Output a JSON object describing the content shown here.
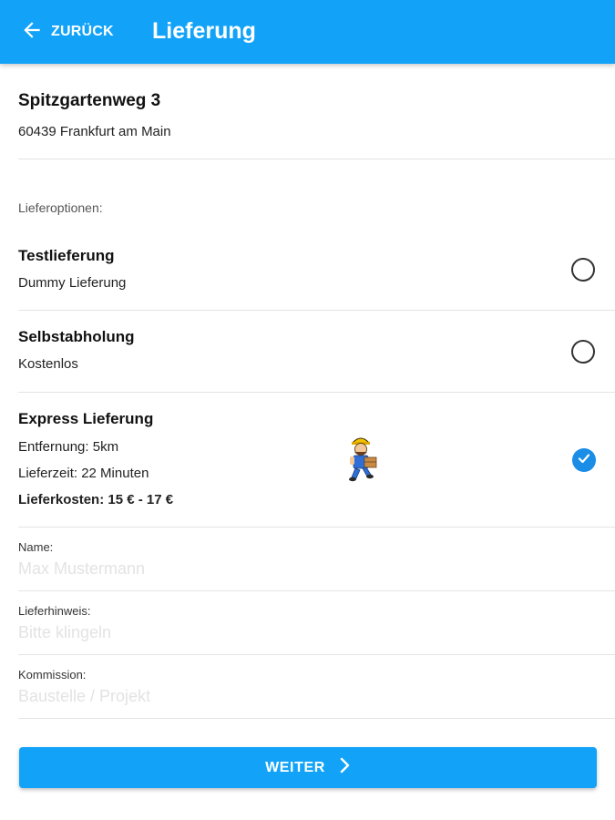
{
  "header": {
    "back_label": "ZURÜCK",
    "title": "Lieferung",
    "color": "#12a3f8"
  },
  "address": {
    "street": "Spitzgartenweg 3",
    "city": "60439 Frankfurt am Main"
  },
  "delivery_options": {
    "section_label": "Lieferoptionen:",
    "items": [
      {
        "title": "Testlieferung",
        "lines": [
          "Dummy Lieferung"
        ],
        "selected": false
      },
      {
        "title": "Selbstabholung",
        "lines": [
          "Kostenlos"
        ],
        "selected": false
      },
      {
        "title": "Express Lieferung",
        "lines": [
          "Entfernung: 5km",
          "Lieferzeit: 22 Minuten",
          "Lieferkosten: 15 € - 17 €"
        ],
        "selected": true,
        "icon": "courier-icon"
      }
    ]
  },
  "form": {
    "name": {
      "label": "Name:",
      "placeholder": "Max Mustermann",
      "value": ""
    },
    "hint": {
      "label": "Lieferhinweis:",
      "placeholder": "Bitte klingeln",
      "value": ""
    },
    "commission": {
      "label": "Kommission:",
      "placeholder": "Baustelle / Projekt",
      "value": ""
    }
  },
  "footer": {
    "next_label": "WEITER"
  },
  "colors": {
    "accent": "#12a3f8",
    "radio_checked": "#1a8ee6"
  }
}
